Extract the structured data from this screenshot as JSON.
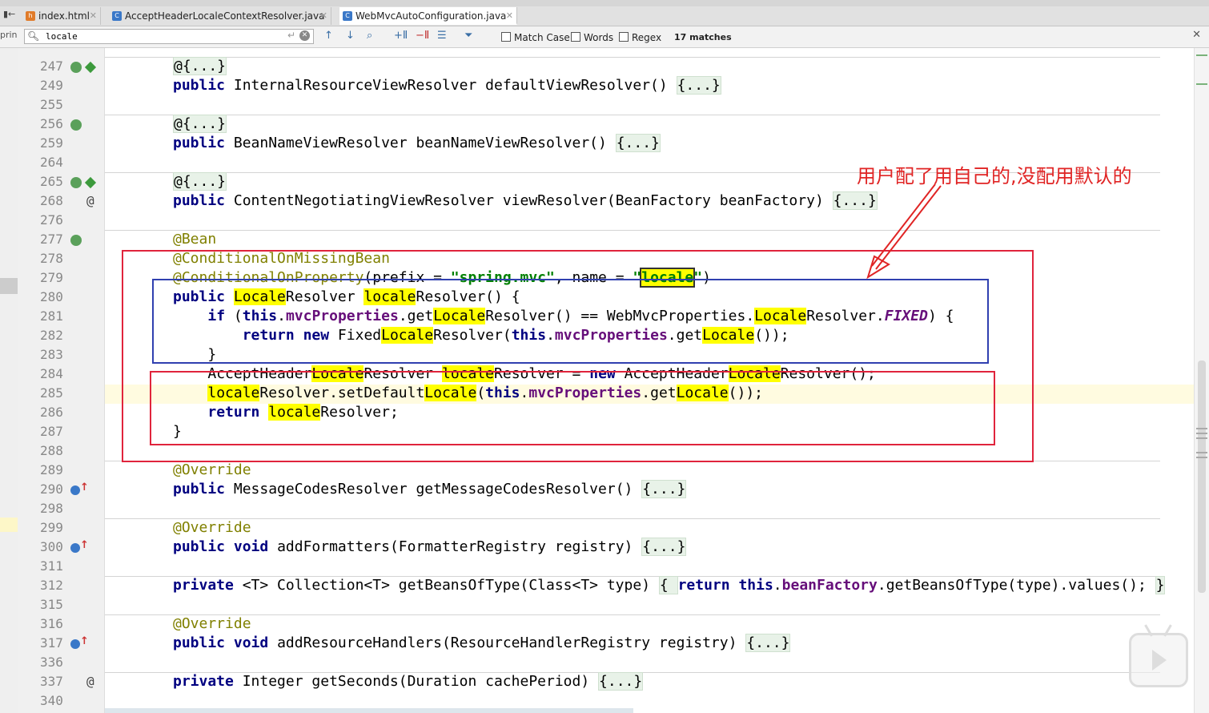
{
  "tabs": [
    {
      "label": "index.html",
      "icon": "html-file-icon"
    },
    {
      "label": "AcceptHeaderLocaleContextResolver.java",
      "icon": "java-class-icon"
    },
    {
      "label": "WebMvcAutoConfiguration.java",
      "icon": "java-class-icon",
      "active": true
    }
  ],
  "find": {
    "side_label": "prin",
    "query": "locale",
    "options": {
      "match_case": "Match Case",
      "words": "Words",
      "regex": "Regex"
    },
    "matches": "17 matches"
  },
  "gutter": {
    "line_numbers": [
      "247",
      "249",
      "255",
      "256",
      "259",
      "264",
      "265",
      "268",
      "276",
      "277",
      "278",
      "279",
      "280",
      "281",
      "282",
      "283",
      "284",
      "285",
      "286",
      "287",
      "288",
      "289",
      "290",
      "298",
      "299",
      "300",
      "311",
      "312",
      "315",
      "316",
      "317",
      "336",
      "337",
      "340"
    ]
  },
  "code": {
    "l247": "@{...}",
    "l249_kw": "public",
    "l249_rest": " InternalResourceViewResolver defaultViewResolver() ",
    "l249_fold": "{...}",
    "l256": "@{...}",
    "l259_kw": "public",
    "l259_rest": " BeanNameViewResolver beanNameViewResolver() ",
    "l259_fold": "{...}",
    "l265": "@{...}",
    "l268_kw": "public",
    "l268_rest": " ContentNegotiatingViewResolver viewResolver(BeanFactory beanFactory) ",
    "l268_fold": "{...}",
    "l277": "@Bean",
    "l278": "@ConditionalOnMissingBean",
    "l279_a": "@ConditionalOnProperty",
    "l279_b": "(prefix = ",
    "l279_s1": "\"spring.mvc\"",
    "l279_c": ", name = ",
    "l279_q1": "\"",
    "l279_hl": "locale",
    "l279_q2": "\"",
    "l279_d": ")",
    "l280_kw": "public",
    "l280_h1": "Locale",
    "l280_a": "Resolver ",
    "l280_h2": "locale",
    "l280_b": "Resolver() {",
    "l281_kw": "if",
    "l281_a": " (",
    "l281_this": "this",
    "l281_dot": ".",
    "l281_fld": "mvcProperties",
    "l281_b": ".get",
    "l281_h1": "Locale",
    "l281_c": "Resolver() == WebMvcProperties.",
    "l281_h2": "Locale",
    "l281_d": "Resolver.",
    "l281_fx": "FIXED",
    "l281_e": ") {",
    "l282_kw1": "return",
    "l282_kw2": "new",
    "l282_a": " Fixed",
    "l282_h1": "Locale",
    "l282_b": "Resolver(",
    "l282_this": "this",
    "l282_dot": ".",
    "l282_fld": "mvcProperties",
    "l282_c": ".get",
    "l282_h2": "Locale",
    "l282_d": "());",
    "l283": "}",
    "l284_a": "AcceptHeader",
    "l284_h1": "Locale",
    "l284_b": "Resolver ",
    "l284_h2": "locale",
    "l284_c": "Resolver = ",
    "l284_kw": "new",
    "l284_d": " AcceptHeader",
    "l284_h3": "Locale",
    "l284_e": "Resolver();",
    "l285_h1": "locale",
    "l285_a": "Resolver.setDefault",
    "l285_h2": "Locale",
    "l285_b": "(",
    "l285_this": "this",
    "l285_dot": ".",
    "l285_fld": "mvcProperties",
    "l285_c": ".get",
    "l285_h3": "Locale",
    "l285_d": "());",
    "l286_kw": "return",
    "l286_h1": "locale",
    "l286_a": "Resolver;",
    "l287": "}",
    "l289": "@Override",
    "l290_kw": "public",
    "l290_rest": " MessageCodesResolver getMessageCodesResolver() ",
    "l290_fold": "{...}",
    "l299": "@Override",
    "l300_kw1": "public",
    "l300_kw2": "void",
    "l300_rest": " addFormatters(FormatterRegistry registry) ",
    "l300_fold": "{...}",
    "l312_kw": "private",
    "l312_a": " <T> Collection<T> getBeansOfType(Class<T> type) ",
    "l312_f1": "{ ",
    "l312_kw2": "return",
    "l312_sp": " ",
    "l312_this": "this",
    "l312_dot": ".",
    "l312_fld": "beanFactory",
    "l312_b": ".getBeansOfType(type).values(); ",
    "l312_f2": "}",
    "l316": "@Override",
    "l317_kw1": "public",
    "l317_kw2": "void",
    "l317_rest": " addResourceHandlers(ResourceHandlerRegistry registry) ",
    "l317_fold": "{...}",
    "l337_kw": "private",
    "l337_rest": " Integer getSeconds(Duration cachePeriod) ",
    "l337_fold": "{...}"
  },
  "annotation_note": "用户配了用自己的,没配用默认的",
  "colors": {
    "red_box": "#e0243c",
    "blue_box": "#3040b0",
    "highlight": "#ffff00"
  }
}
